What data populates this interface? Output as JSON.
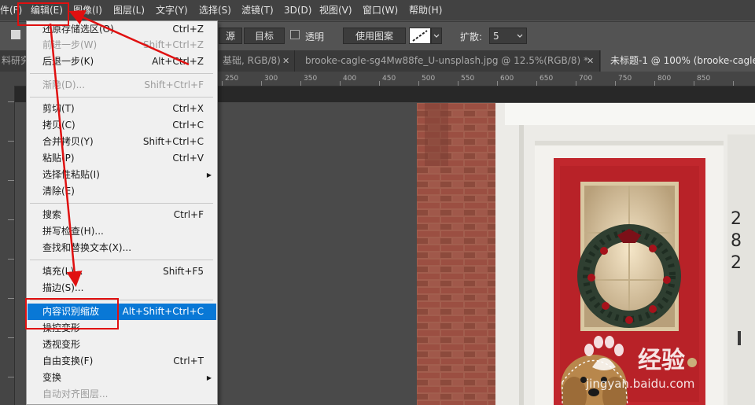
{
  "menubar": {
    "items": [
      {
        "label": "件(F)"
      },
      {
        "label": "编辑(E)"
      },
      {
        "label": "图像(I)"
      },
      {
        "label": "图层(L)"
      },
      {
        "label": "文字(Y)"
      },
      {
        "label": "选择(S)"
      },
      {
        "label": "滤镜(T)"
      },
      {
        "label": "3D(D)"
      },
      {
        "label": "视图(V)"
      },
      {
        "label": "窗口(W)"
      },
      {
        "label": "帮助(H)"
      }
    ]
  },
  "options": {
    "source_label": "源",
    "target_label": "目标",
    "transparent_label": "透明",
    "use_pattern_label": "使用图案",
    "diffusion_label": "扩散:",
    "diffusion_value": "5"
  },
  "tabs": [
    {
      "label": "料研究"
    },
    {
      "label": "基础, RGB/8)"
    },
    {
      "label": "brooke-cagle-sg4Mw88fe_U-unsplash.jpg @ 12.5%(RGB/8) *"
    },
    {
      "label": "未标题-1 @ 100% (brooke-cagle"
    }
  ],
  "ruler": {
    "labels": [
      "250",
      "300",
      "350",
      "400",
      "450",
      "500",
      "550",
      "600",
      "650",
      "700",
      "750",
      "800",
      "850"
    ]
  },
  "edit_menu": {
    "items": [
      {
        "label": "还原存储选区(O)",
        "shortcut": "Ctrl+Z",
        "disabled": false
      },
      {
        "label": "前进一步(W)",
        "shortcut": "Shift+Ctrl+Z",
        "disabled": true
      },
      {
        "label": "后退一步(K)",
        "shortcut": "Alt+Ctrl+Z",
        "disabled": false
      },
      {
        "label": "渐隐(D)...",
        "shortcut": "Shift+Ctrl+F",
        "disabled": true
      },
      {
        "label": "剪切(T)",
        "shortcut": "Ctrl+X",
        "disabled": false
      },
      {
        "label": "拷贝(C)",
        "shortcut": "Ctrl+C",
        "disabled": false
      },
      {
        "label": "合并拷贝(Y)",
        "shortcut": "Shift+Ctrl+C",
        "disabled": false
      },
      {
        "label": "粘贴(P)",
        "shortcut": "Ctrl+V",
        "disabled": false
      },
      {
        "label": "选择性粘贴(I)",
        "shortcut": "",
        "submenu": true,
        "disabled": false
      },
      {
        "label": "清除(E)",
        "shortcut": "",
        "disabled": false
      },
      {
        "label": "搜索",
        "shortcut": "Ctrl+F",
        "disabled": false
      },
      {
        "label": "拼写检查(H)...",
        "shortcut": "",
        "disabled": false
      },
      {
        "label": "查找和替换文本(X)...",
        "shortcut": "",
        "disabled": false
      },
      {
        "label": "填充(L)...",
        "shortcut": "Shift+F5",
        "disabled": false
      },
      {
        "label": "描边(S)...",
        "shortcut": "",
        "disabled": false
      },
      {
        "label": "内容识别缩放",
        "shortcut": "Alt+Shift+Ctrl+C",
        "disabled": false,
        "highlighted": true
      },
      {
        "label": "操控变形",
        "shortcut": "",
        "disabled": false
      },
      {
        "label": "透视变形",
        "shortcut": "",
        "disabled": false
      },
      {
        "label": "自由变换(F)",
        "shortcut": "Ctrl+T",
        "disabled": false
      },
      {
        "label": "变换",
        "shortcut": "",
        "submenu": true,
        "disabled": false
      },
      {
        "label": "自动对齐图层...",
        "shortcut": "",
        "disabled": true
      }
    ]
  },
  "photo": {
    "house_number": [
      "2",
      "8",
      "2"
    ]
  },
  "watermark": {
    "brand": "经验",
    "url": "jingyan.baidu.com"
  },
  "colors": {
    "highlight": "#0978d6",
    "annotation": "#e01010",
    "door_red": "#c1272d"
  }
}
